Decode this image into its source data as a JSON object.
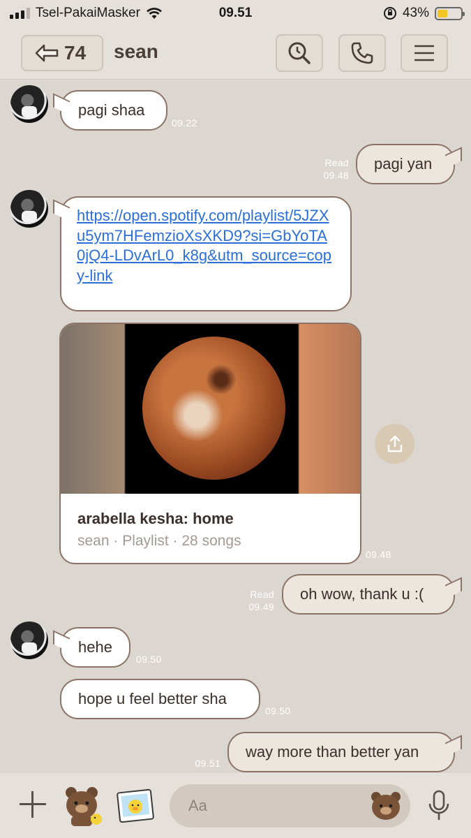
{
  "status_bar": {
    "carrier": "Tsel-PakaiMasker",
    "time": "09.51",
    "battery": "43%",
    "battery_level": 0.43
  },
  "header": {
    "back_count": "74",
    "title": "sean"
  },
  "messages": {
    "m1": {
      "text": "pagi shaa",
      "time": "09.22"
    },
    "m2": {
      "text": "pagi yan",
      "read": "Read",
      "time": "09.48"
    },
    "m3": {
      "url": "https://open.spotify.com/playlist/5JZXu5ym7HFemzioXsXKD9?si=GbYoTA0jQ4-LDvArL0_k8g&utm_source=copy-link"
    },
    "card": {
      "title": "arabella kesha: home",
      "subtitle": "sean · Playlist · 28 songs",
      "time": "09.48"
    },
    "m4": {
      "text": "oh wow, thank u :(",
      "read": "Read",
      "time": "09.49"
    },
    "m5": {
      "text": "hehe",
      "time": "09.50"
    },
    "m6": {
      "text": "hope u feel better sha",
      "time": "09.50"
    },
    "m7": {
      "text": "way more than better yan",
      "time": "09.51"
    }
  },
  "input": {
    "placeholder": "Aa"
  },
  "icons": {
    "back": "back-arrow-icon",
    "search": "search-icon",
    "call": "phone-icon",
    "menu": "hamburger-menu-icon",
    "share": "share-icon",
    "add": "plus-icon",
    "sticker_bear": "brown-bear-sticker-icon",
    "sticker_photo": "sally-photo-sticker-icon",
    "emoji": "emoji-icon",
    "mic": "microphone-icon"
  },
  "colors": {
    "background": "#dcd6d0",
    "bubble_border": "#8b7467",
    "link": "#2b6fd6",
    "battery_fill": "#f3c623"
  }
}
